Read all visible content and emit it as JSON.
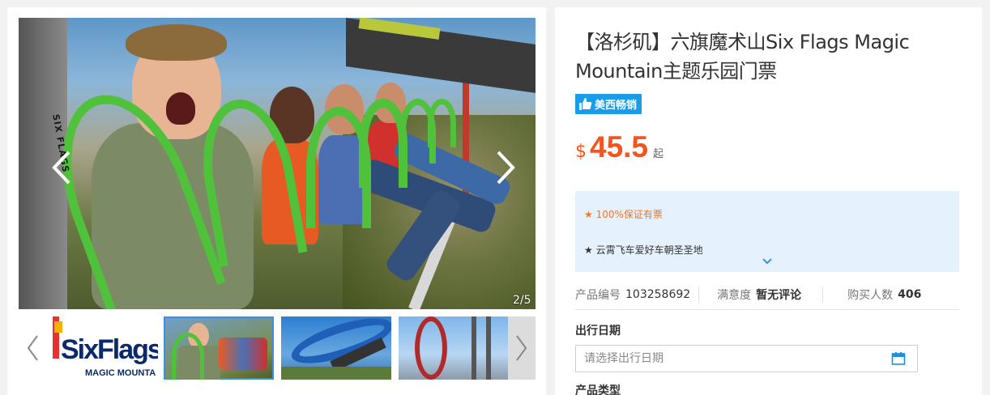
{
  "gallery": {
    "counter": "2/5",
    "harness_text": "SIX FLAGS",
    "thumbnails": [
      {
        "id": "logo",
        "logo_text": "SixFlags",
        "logo_sub": "MAGIC MOUNTA"
      },
      {
        "id": "riders",
        "active": true
      },
      {
        "id": "coaster-loop"
      },
      {
        "id": "coaster-track"
      }
    ]
  },
  "product": {
    "title": "【洛杉矶】六旗魔术山Six Flags Magic Mountain主题乐园门票",
    "badge": "美西畅销",
    "price": {
      "currency": "$",
      "value": "45.5",
      "suffix": "起"
    },
    "features": [
      "★ 100%保证有票",
      "★ 云霄飞车爱好车朝圣圣地"
    ],
    "stats": [
      {
        "label": "产品编号",
        "value": "103258692"
      },
      {
        "label": "满意度",
        "value": "暂无评论"
      },
      {
        "label": "购买人数",
        "value": "406"
      }
    ],
    "date_label": "出行日期",
    "date_placeholder": "请选择出行日期",
    "type_label": "产品类型"
  },
  "colors": {
    "accent_blue": "#1a9ce8",
    "price_orange": "#f4541d",
    "feature_orange": "#f07828",
    "feature_bg": "#e5f1fc"
  }
}
